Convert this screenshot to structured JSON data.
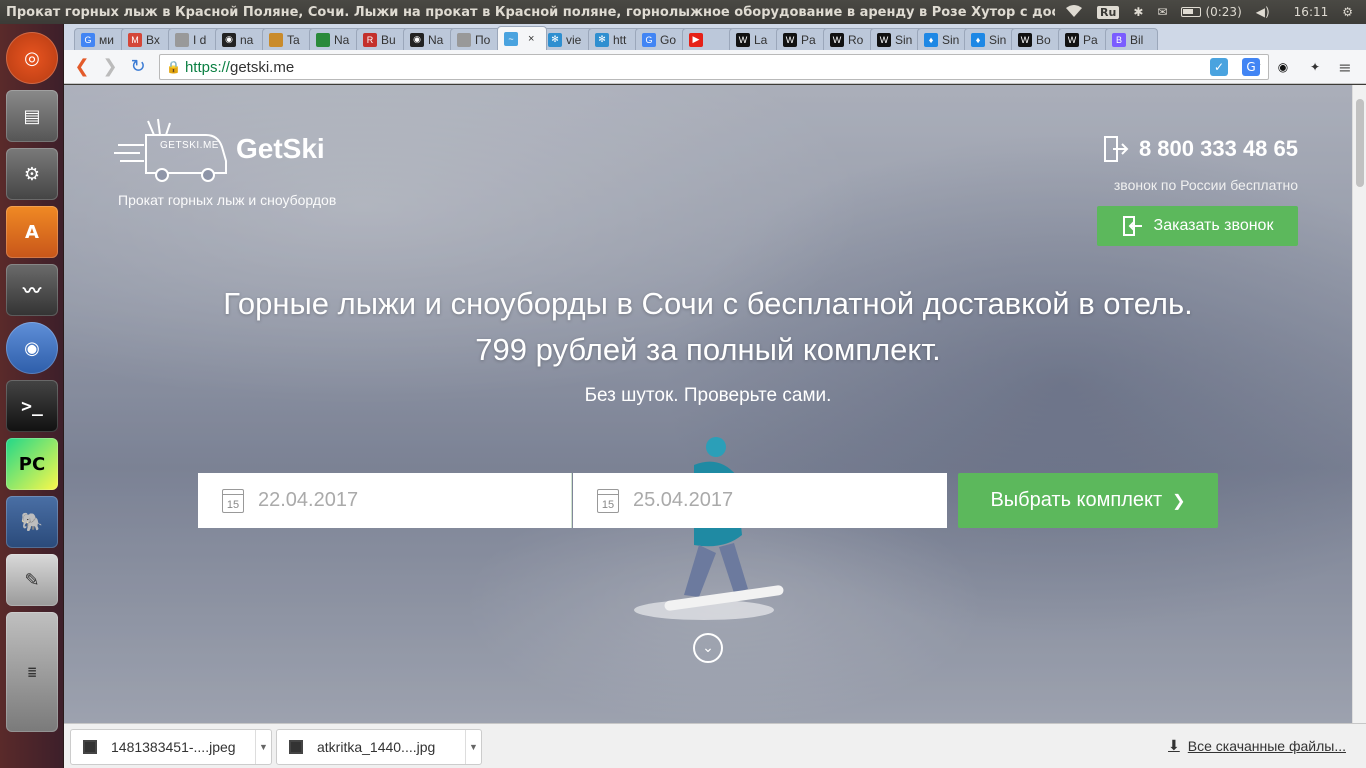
{
  "system": {
    "window_title": "Прокат горных лыж в Красной Поляне, Сочи. Лыжи на прокат в Красной поляне, горнолыжное оборудование в аренду в Розе Хутор с достав",
    "keyboard_layout": "Ru",
    "battery": "(0:23)",
    "clock": "16:11"
  },
  "tabs": [
    {
      "label": "ми",
      "color": "#4285f4",
      "glyph": "G"
    },
    {
      "label": "Вх",
      "color": "#d44638",
      "glyph": "M"
    },
    {
      "label": "I d",
      "color": "#999999",
      "glyph": ""
    },
    {
      "label": "na",
      "color": "#222222",
      "glyph": "◉"
    },
    {
      "label": "Ta",
      "color": "#c98b2b",
      "glyph": ""
    },
    {
      "label": "Na",
      "color": "#2a8a3a",
      "glyph": ""
    },
    {
      "label": "Bu",
      "color": "#c4302b",
      "glyph": "R"
    },
    {
      "label": "Na",
      "color": "#222222",
      "glyph": "◉"
    },
    {
      "label": "По",
      "color": "#999999",
      "glyph": ""
    },
    {
      "label": "",
      "color": "#4aa3df",
      "glyph": "~",
      "active": true
    },
    {
      "label": "vie",
      "color": "#2f8fd0",
      "glyph": "✻"
    },
    {
      "label": "htt",
      "color": "#2f8fd0",
      "glyph": "✻"
    },
    {
      "label": "Go",
      "color": "#4285f4",
      "glyph": "G"
    },
    {
      "label": "",
      "color": "#e62117",
      "glyph": "▶"
    },
    {
      "label": "La",
      "color": "#111111",
      "glyph": "W"
    },
    {
      "label": "Pa",
      "color": "#111111",
      "glyph": "W"
    },
    {
      "label": "Ro",
      "color": "#111111",
      "glyph": "W"
    },
    {
      "label": "Sin",
      "color": "#111111",
      "glyph": "W"
    },
    {
      "label": "Sin",
      "color": "#1e88e5",
      "glyph": "♦"
    },
    {
      "label": "Sin",
      "color": "#1e88e5",
      "glyph": "♦"
    },
    {
      "label": "Bo",
      "color": "#111111",
      "glyph": "W"
    },
    {
      "label": "Pa",
      "color": "#111111",
      "glyph": "W"
    },
    {
      "label": "Bil",
      "color": "#7a5cff",
      "glyph": "B"
    }
  ],
  "browser": {
    "url_scheme": "https://",
    "url_host": "getski.me"
  },
  "site": {
    "brand": "GetSki",
    "truck_text": "GETSKI.ME",
    "tagline": "Прокат горных лыж и сноубордов",
    "phone": "8 800 333 48 65",
    "phone_note": "звонок по России бесплатно",
    "call_button": "Заказать звонок",
    "headline_line1": "Горные лыжи и сноуборды в Сочи с бесплатной доставкой в отель.",
    "headline_line2": "799 рублей за полный комплект.",
    "subheadline": "Без шуток. Проверьте сами.",
    "date_from": "22.04.2017",
    "date_to": "25.04.2017",
    "calendar_day": "15",
    "choose_button": "Выбрать комплект",
    "accent_color": "#5cb85c"
  },
  "downloads": {
    "items": [
      {
        "name": "1481383451-....jpeg"
      },
      {
        "name": "atkritka_1440....jpg"
      }
    ],
    "all_link": "Все скачанные файлы..."
  }
}
